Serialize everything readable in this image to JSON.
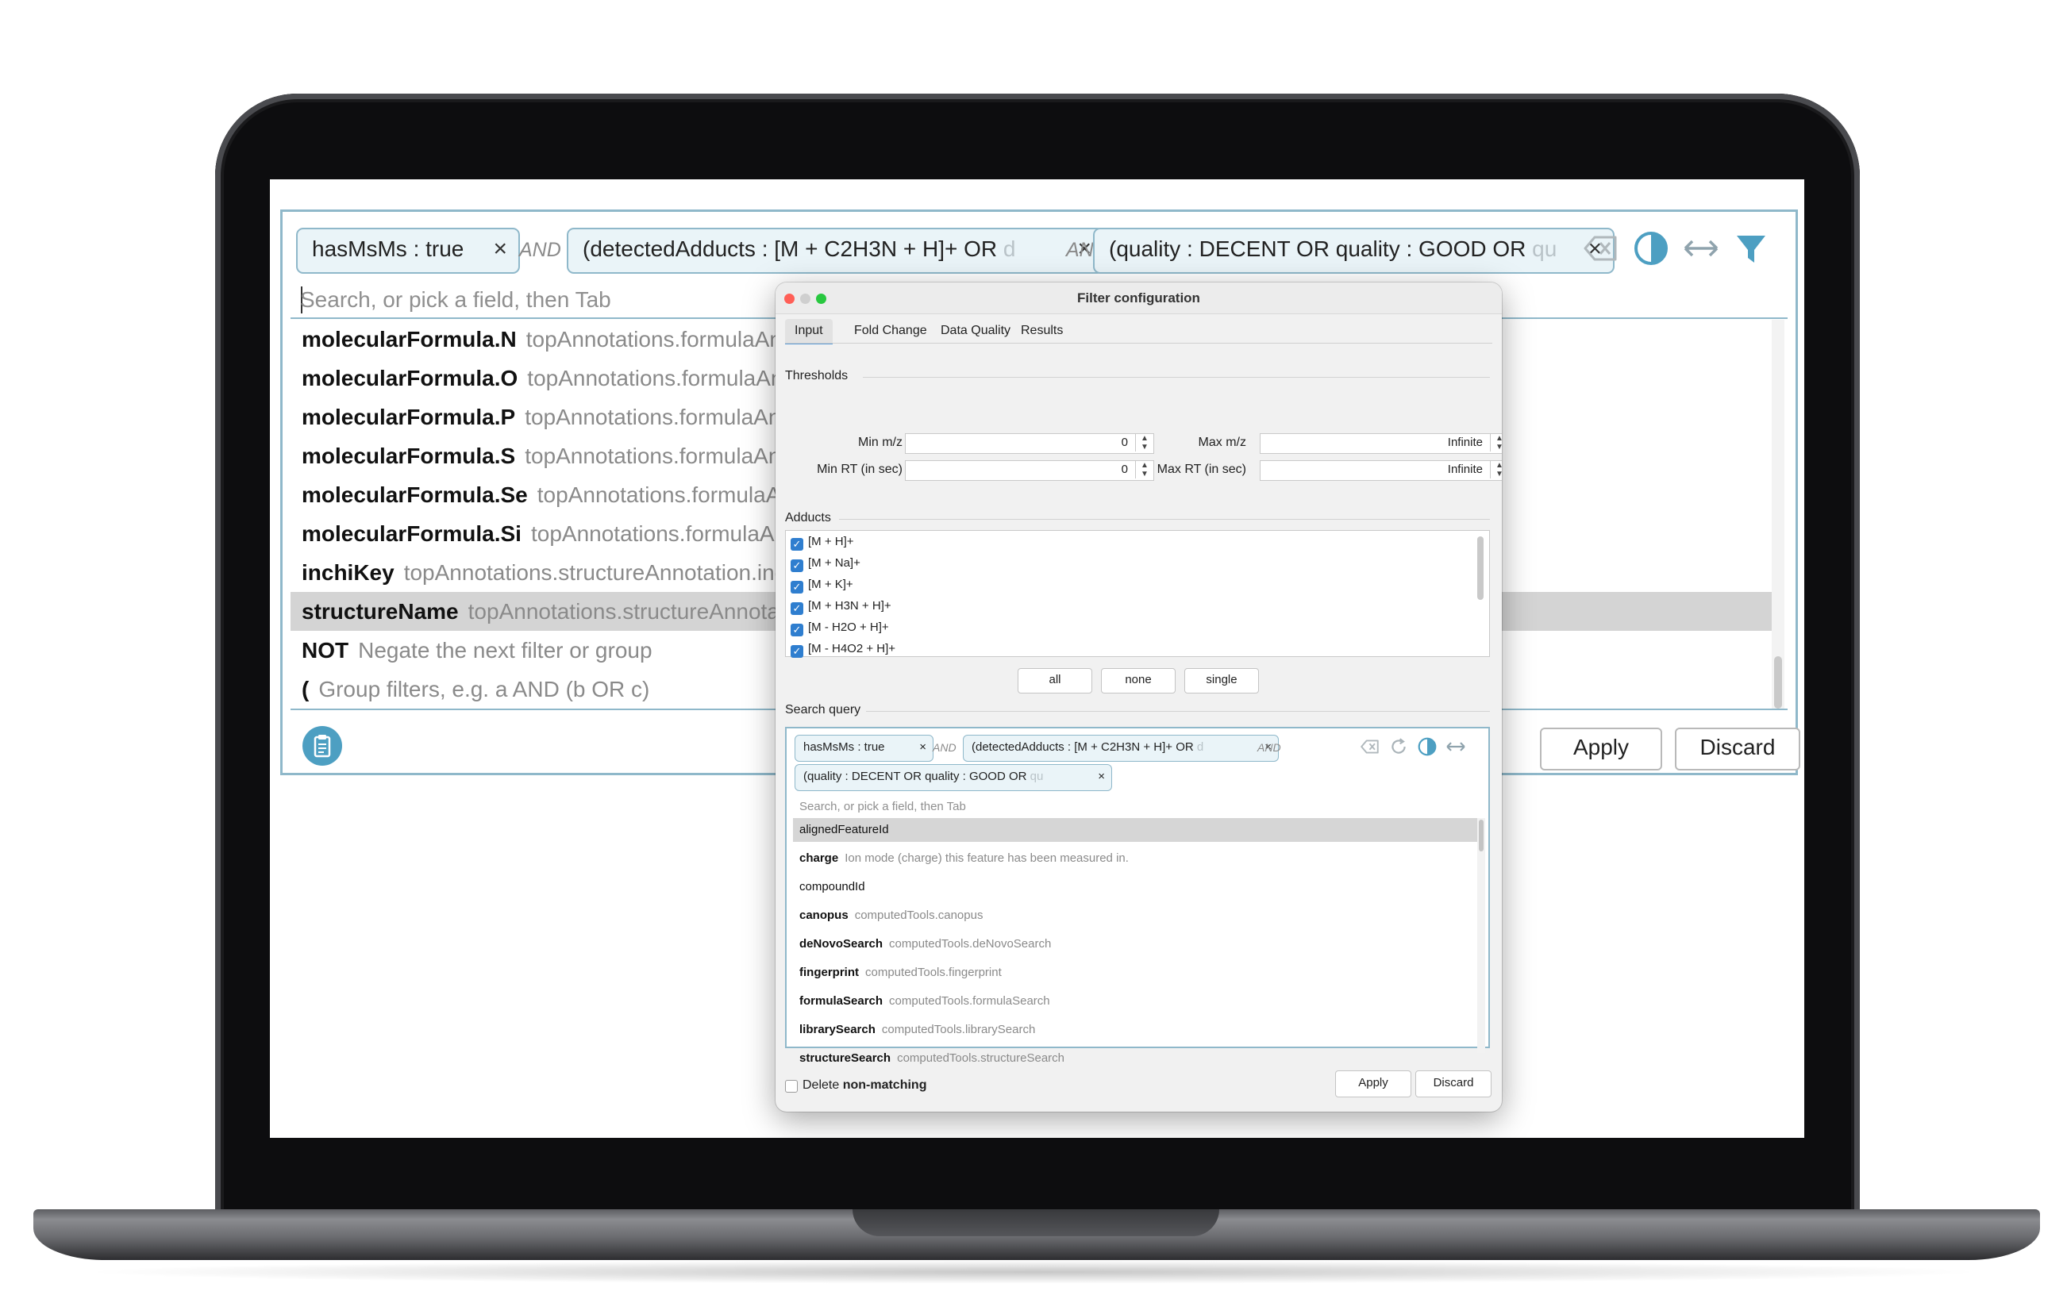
{
  "colors": {
    "accent": "#8fb8ca",
    "chip_bg": "#eaf4f8",
    "selected_row": "#d4d4d4",
    "icon_blue": "#4d9fc2",
    "checkbox_blue": "#2f7ecf"
  },
  "main_panel": {
    "chips": [
      {
        "text": "hasMsMs : true",
        "faded": ""
      },
      {
        "text": "(detectedAdducts : [M + C2H3N + H]+ OR ",
        "faded": "d"
      },
      {
        "text": "(quality : DECENT OR quality : GOOD OR ",
        "faded": "qu"
      }
    ],
    "chip_close": "×",
    "operators": [
      "AND",
      "AND"
    ],
    "toolbar_icons": [
      "clear-backspace-icon",
      "contrast-toggle-icon",
      "expand-horizontal-icon",
      "filter-funnel-icon"
    ],
    "search_placeholder": "Search, or pick a field, then Tab",
    "suggestions": [
      {
        "field": "molecularFormula.N",
        "desc": "topAnnotations.formulaAnn"
      },
      {
        "field": "molecularFormula.O",
        "desc": "topAnnotations.formulaAnn"
      },
      {
        "field": "molecularFormula.P",
        "desc": "topAnnotations.formulaAnn"
      },
      {
        "field": "molecularFormula.S",
        "desc": "topAnnotations.formulaAnn"
      },
      {
        "field": "molecularFormula.Se",
        "desc": "topAnnotations.formulaAn"
      },
      {
        "field": "molecularFormula.Si",
        "desc": "topAnnotations.formulaAnn"
      },
      {
        "field": "inchiKey",
        "desc": "topAnnotations.structureAnnotation.inc"
      },
      {
        "field": "structureName",
        "desc": "topAnnotations.structureAnnota"
      },
      {
        "field": "NOT",
        "desc": "Negate the next filter or group"
      },
      {
        "field": "(",
        "desc": "Group filters, e.g. a AND (b OR c)"
      }
    ],
    "selected_index": 7,
    "apply_label": "Apply",
    "discard_label": "Discard"
  },
  "dialog": {
    "title": "Filter configuration",
    "tabs": [
      "Input",
      "Fold Change",
      "Data Quality",
      "Results"
    ],
    "active_tab": "Input",
    "thresholds_label": "Thresholds",
    "fields": {
      "min_mz": {
        "label": "Min m/z",
        "value": "0"
      },
      "max_mz": {
        "label": "Max m/z",
        "value": "Infinite"
      },
      "min_rt": {
        "label": "Min RT (in sec)",
        "value": "0"
      },
      "max_rt": {
        "label": "Max RT (in sec)",
        "value": "Infinite"
      }
    },
    "adducts_label": "Adducts",
    "adducts": [
      {
        "label": "[M + H]+",
        "checked": true
      },
      {
        "label": "[M + Na]+",
        "checked": true
      },
      {
        "label": "[M + K]+",
        "checked": true
      },
      {
        "label": "[M + H3N + H]+",
        "checked": true
      },
      {
        "label": "[M - H2O + H]+",
        "checked": true
      },
      {
        "label": "[M - H4O2 + H]+",
        "checked": true
      }
    ],
    "select_buttons": [
      "all",
      "none",
      "single"
    ],
    "search_query_label": "Search query",
    "query_chips": [
      {
        "text": "hasMsMs : true",
        "faded": ""
      },
      {
        "text": "(detectedAdducts : [M + C2H3N + H]+ OR ",
        "faded": "d"
      },
      {
        "text": "(quality : DECENT OR quality : GOOD OR ",
        "faded": "qu"
      }
    ],
    "query_operators": [
      "AND",
      "AND"
    ],
    "query_icons": [
      "clear-backspace-icon",
      "refresh-icon",
      "contrast-toggle-icon",
      "expand-horizontal-icon"
    ],
    "query_placeholder": "Search, or pick a field, then Tab",
    "query_suggestions": [
      {
        "field": "alignedFeatureId",
        "desc": "",
        "bold": false
      },
      {
        "field": "charge",
        "desc": "Ion mode (charge) this feature has been measured in.",
        "bold": true
      },
      {
        "field": "compoundId",
        "desc": "",
        "bold": false
      },
      {
        "field": "canopus",
        "desc": "computedTools.canopus",
        "bold": true
      },
      {
        "field": "deNovoSearch",
        "desc": "computedTools.deNovoSearch",
        "bold": true
      },
      {
        "field": "fingerprint",
        "desc": "computedTools.fingerprint",
        "bold": true
      },
      {
        "field": "formulaSearch",
        "desc": "computedTools.formulaSearch",
        "bold": true
      },
      {
        "field": "librarySearch",
        "desc": "computedTools.librarySearch",
        "bold": true
      },
      {
        "field": "structureSearch",
        "desc": "computedTools.structureSearch",
        "bold": true
      }
    ],
    "query_selected_index": 0,
    "delete_prefix": "Delete ",
    "delete_bold": "non-matching",
    "delete_checked": false,
    "apply_label": "Apply",
    "discard_label": "Discard"
  }
}
